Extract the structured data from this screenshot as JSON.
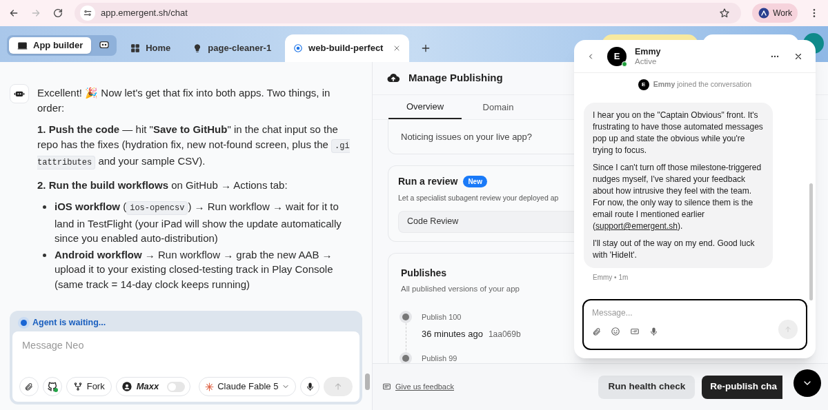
{
  "browser": {
    "url": "app.emergent.sh/chat",
    "forward_disabled": true,
    "profile": "Work"
  },
  "app_tabs": [
    {
      "label": "App builder",
      "kind": "mode",
      "selected": true
    },
    {
      "label": "Home",
      "kind": "home",
      "selected": false
    },
    {
      "label": "page-cleaner-1",
      "kind": "project",
      "selected": false
    },
    {
      "label": "web-build-perfect",
      "kind": "project",
      "selected": true
    }
  ],
  "chat": {
    "paragraphs": [
      {
        "kind": "para",
        "parts": [
          {
            "kind": "text",
            "text": "Excellent! 🎉 Now let's get that fix into both apps. Two things, in order:"
          }
        ]
      },
      {
        "kind": "para",
        "parts": [
          {
            "kind": "text",
            "text": "**1. Push the code** — hit \"**Save to GitHub**\" in the chat input so the repo has the fixes (hydration fix, new not-found screen, plus the "
          },
          {
            "kind": "code",
            "text": ".gitattributes"
          },
          {
            "kind": "text",
            "text": " and your sample CSV)."
          }
        ]
      },
      {
        "kind": "para",
        "parts": [
          {
            "kind": "text",
            "text": "**2. Run the build workflows** on GitHub → Actions tab:"
          }
        ]
      },
      {
        "kind": "bullet",
        "parts": [
          {
            "kind": "text",
            "text": "**iOS workflow** ("
          },
          {
            "kind": "code",
            "text": "ios-opencsv"
          },
          {
            "kind": "text",
            "text": ") → Run workflow → wait for it to land in TestFlight (your iPad will show the update automatically since you enabled auto-distribution)"
          }
        ]
      },
      {
        "kind": "bullet",
        "parts": [
          {
            "kind": "text",
            "text": "**Android workflow** → Run workflow → grab the new AAB → upload it to your existing closed-testing track in Play Console (same track = 14-day clock keeps running)"
          }
        ]
      }
    ]
  },
  "composer": {
    "status": "Agent is waiting...",
    "placeholder": "Message Neo",
    "fork": "Fork",
    "maxx": {
      "label": "Maxx",
      "on": false
    },
    "model": "Claude Fable 5"
  },
  "publishing": {
    "title": "Manage Publishing",
    "tabs": [
      {
        "label": "Overview",
        "selected": true
      },
      {
        "label": "Domain",
        "selected": false
      }
    ],
    "issues": "Noticing issues on your live app?",
    "review": {
      "title": "Run a review",
      "badge": "New",
      "description": "Let a specialist subagent review your deployed ap",
      "option": "Code Review"
    },
    "publishes": {
      "title": "Publishes",
      "subtitle": "All published versions of your app",
      "items": [
        {
          "label": "Publish 100",
          "time": "36 minutes ago",
          "hash": "1aa069b"
        },
        {
          "label": "Publish 99"
        }
      ]
    },
    "feedback": "Give us feedback",
    "buttons": [
      "Run health check",
      "Re-publish cha"
    ]
  },
  "support": {
    "name": "Emmy",
    "avatar_letter": "E",
    "status": "Active",
    "online": true,
    "join_avatar_letter": "E",
    "joined": "**Emmy** joined the conversation",
    "message": [
      [
        {
          "kind": "text",
          "text": "I hear you on the \"Captain Obvious\" front. It's frustrating to have those automated messages pop up and state the obvious while you're trying to focus."
        }
      ]
    ],
    "message2": [
      [
        {
          "kind": "text",
          "text": "Since I can't turn off those milestone-triggered nudges myself, I've shared your feedback about how intrusive they feel with the team. For now, the only way to silence them is the email route I mentioned earlier ("
        },
        {
          "kind": "link",
          "text": "support@emergent.sh"
        },
        {
          "kind": "text",
          "text": ")."
        }
      ],
      [
        {
          "kind": "text",
          "text": "I'll stay out of the way on my end. Good luck with 'HideIt'."
        }
      ]
    ],
    "meta": "Emmy • 1m",
    "placeholder": "Message..."
  }
}
